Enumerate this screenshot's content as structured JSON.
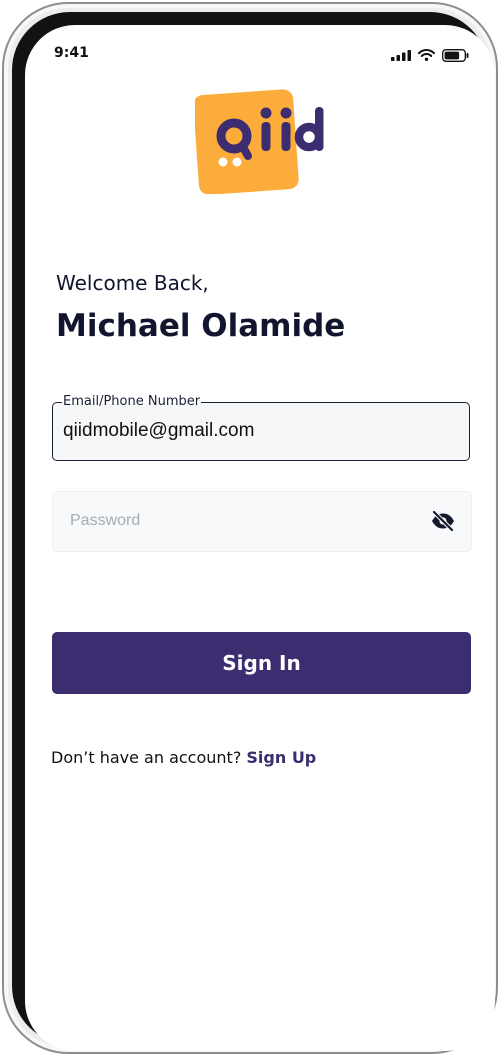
{
  "status_bar": {
    "time": "9:41",
    "icons": [
      "signal-icon",
      "wifi-icon",
      "battery-icon"
    ]
  },
  "brand": {
    "logo_text": "Qiid",
    "colors": {
      "logo_tile": "#fbac3b",
      "logo_text": "#3b2d6f",
      "primary": "#3b2d6f"
    }
  },
  "greeting": {
    "welcome": "Welcome Back,",
    "name": "Michael Olamide"
  },
  "form": {
    "email_label": "Email/Phone Number",
    "email_value": "qiidmobile@gmail.com",
    "password_placeholder": "Password",
    "password_visibility_icon": "eye-off-icon",
    "submit_label": "Sign In"
  },
  "footer": {
    "prompt": "Don’t have an account? ",
    "link_label": "Sign Up"
  }
}
